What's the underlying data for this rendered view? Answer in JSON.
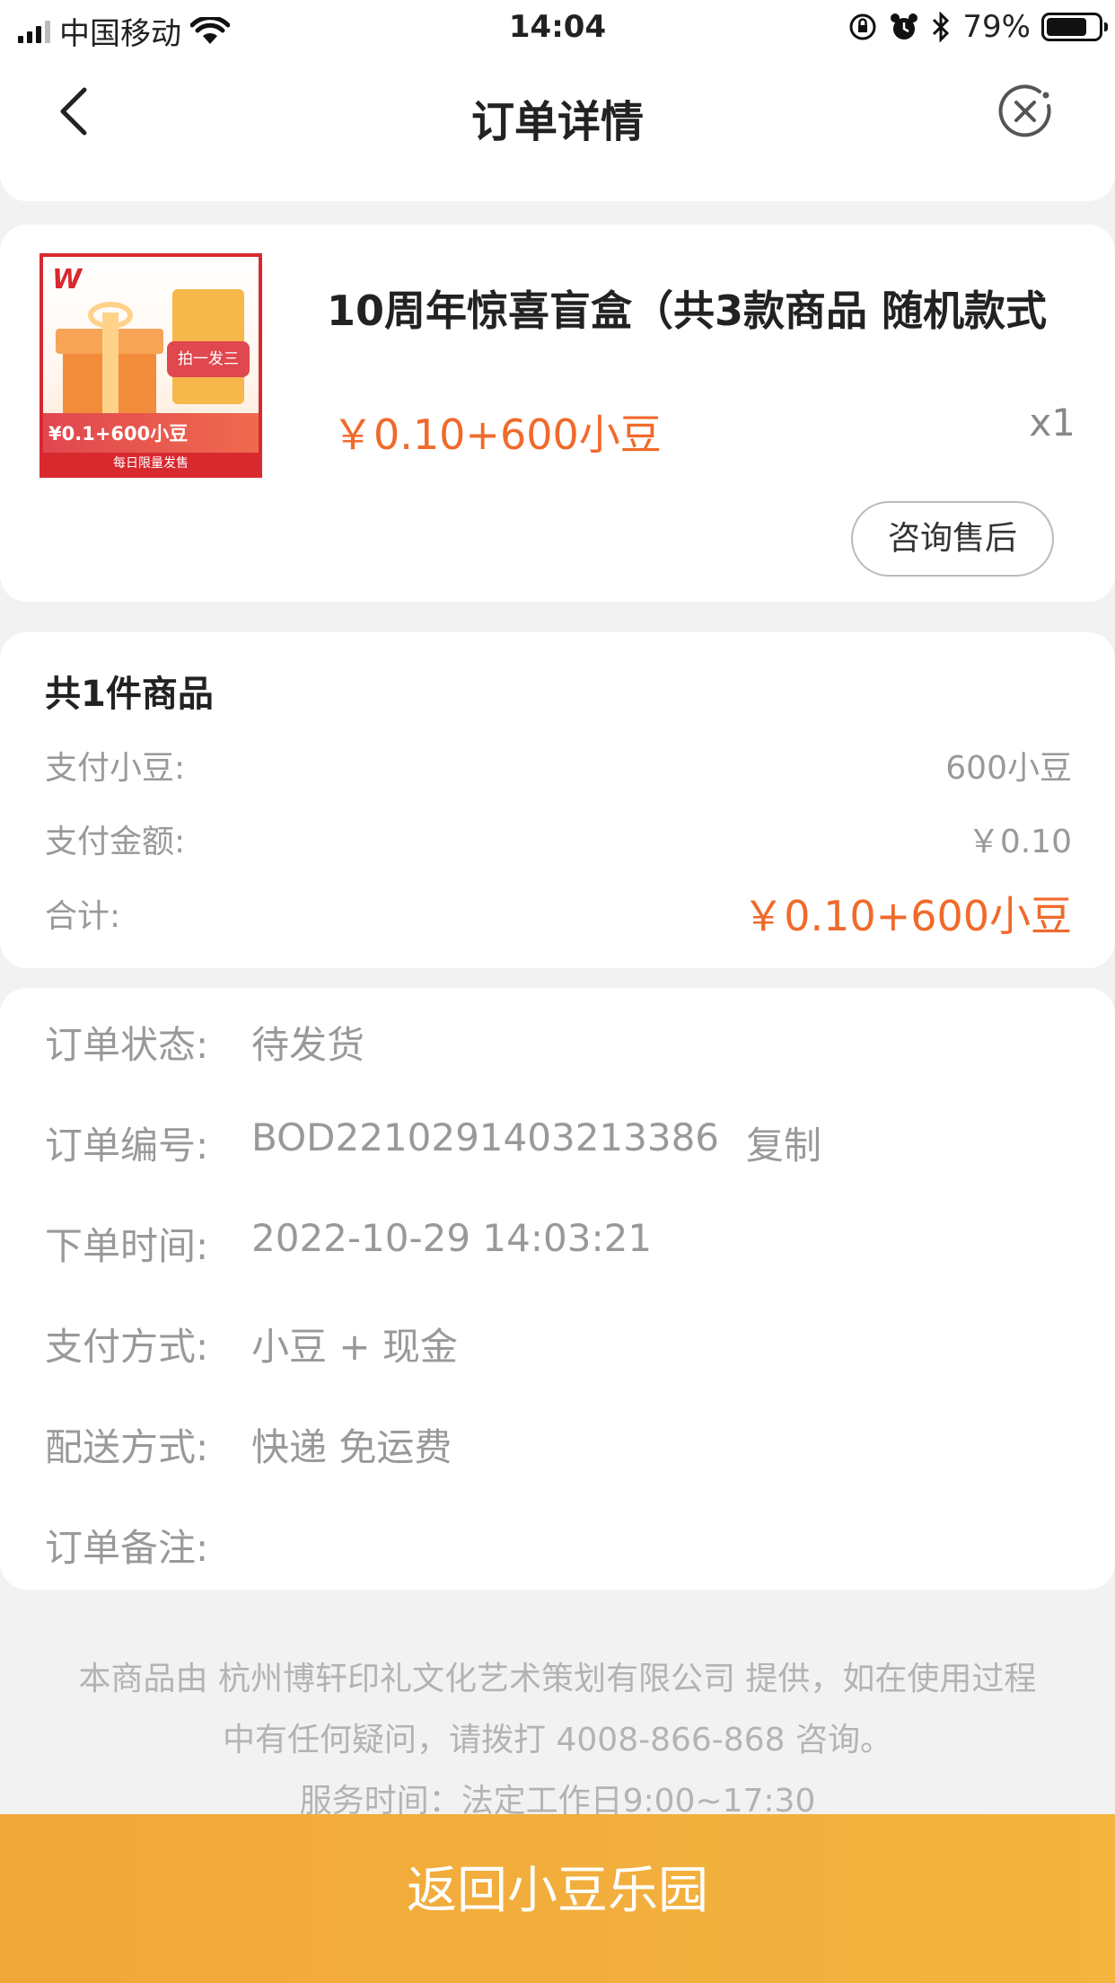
{
  "status_bar": {
    "carrier": "中国移动",
    "time": "14:04",
    "battery": "79%",
    "battery_level": 0.79,
    "icons": [
      "signal-icon",
      "wifi-icon",
      "rotation-lock-icon",
      "alarm-icon",
      "bluetooth-icon",
      "battery-icon"
    ]
  },
  "nav": {
    "title": "订单详情",
    "back_icon": "chevron-left-icon",
    "close_icon": "close-circle-icon"
  },
  "product": {
    "title": "10周年惊喜盲盒（共3款商品 随机款式",
    "price": "￥0.10+600小豆",
    "quantity": "x1",
    "after_sales_button": "咨询售后",
    "thumbnail": {
      "logo": "W",
      "badge": "拍一发三",
      "price_strip": "¥0.1+600小豆",
      "bottom_strip": "每日限量发售"
    }
  },
  "summary": {
    "title": "共1件商品",
    "rows": [
      {
        "label": "支付小豆:",
        "value": "600小豆"
      },
      {
        "label": "支付金额:",
        "value": "￥0.10"
      },
      {
        "label": "合计:",
        "value": "￥0.10+600小豆"
      }
    ]
  },
  "order_info": {
    "rows": [
      {
        "label": "订单状态:",
        "value": "待发货"
      },
      {
        "label": "订单编号:",
        "value": "BOD2210291403213386",
        "action": "复制"
      },
      {
        "label": "下单时间:",
        "value": "2022-10-29 14:03:21"
      },
      {
        "label": "支付方式:",
        "value": "小豆 + 现金"
      },
      {
        "label": "配送方式:",
        "value": "快递 免运费"
      },
      {
        "label": "订单备注:",
        "value": ""
      }
    ]
  },
  "footer": {
    "line1": "本商品由 杭州博轩印礼文化艺术策划有限公司 提供，如在使用过程",
    "line2": "中有任何疑问，请拨打 4008-866-868 咨询。",
    "line3": "服务时间：法定工作日9:00~17:30"
  },
  "bottom_button": "返回小豆乐园",
  "colors": {
    "accent_orange": "#f06a2b",
    "button_gold": "#f3b53f",
    "thumb_red": "#d8292f"
  }
}
